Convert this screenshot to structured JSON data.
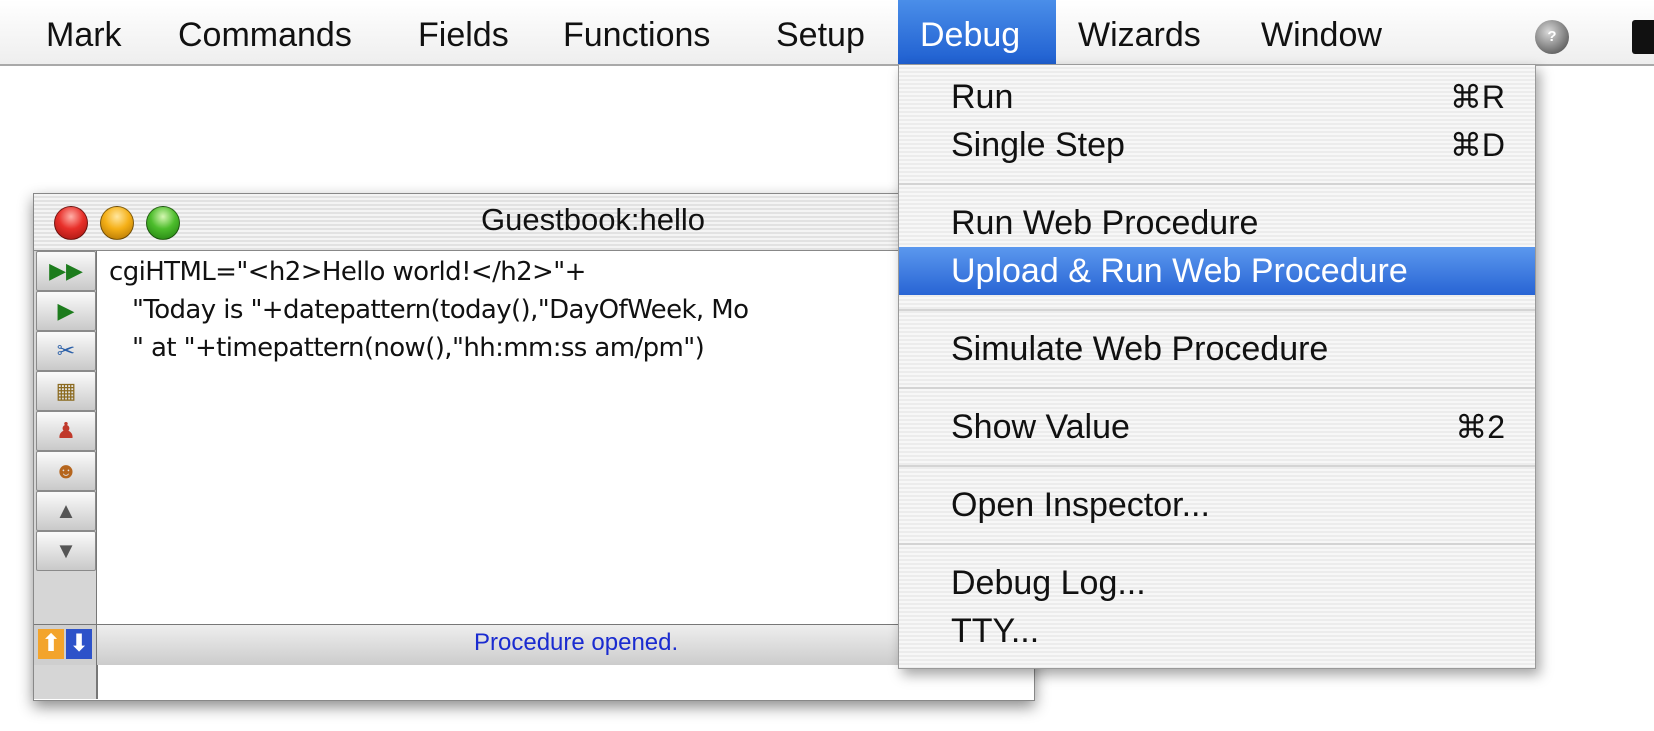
{
  "menubar": {
    "items": [
      {
        "label": "Mark"
      },
      {
        "label": "Commands"
      },
      {
        "label": "Fields"
      },
      {
        "label": "Functions"
      },
      {
        "label": "Setup"
      },
      {
        "label": "Debug",
        "active": true
      },
      {
        "label": "Wizards"
      },
      {
        "label": "Window"
      }
    ],
    "help_icon": "help-globe-icon"
  },
  "window": {
    "title": "Guestbook:hello",
    "code_lines": [
      "cgiHTML=\"<h2>Hello world!</h2>\"+",
      "   \"Today is \"+datepattern(today(),\"DayOfWeek, Mo",
      "   \" at \"+timepattern(now(),\"hh:mm:ss am/pm\")"
    ],
    "tools": [
      {
        "icon": "fast-forward-icon",
        "glyph": "▶▶"
      },
      {
        "icon": "play-icon",
        "glyph": "▶"
      },
      {
        "icon": "scissors-icon",
        "glyph": "✂"
      },
      {
        "icon": "puzzle-icon",
        "glyph": "▦"
      },
      {
        "icon": "stamp-icon",
        "glyph": "♟"
      },
      {
        "icon": "people-icon",
        "glyph": "☻"
      },
      {
        "icon": "scroll-up-icon",
        "glyph": "▲"
      },
      {
        "icon": "scroll-down-icon",
        "glyph": "▼"
      }
    ],
    "status_text": "Procedure opened."
  },
  "debug_menu": {
    "items": [
      {
        "label": "Run",
        "shortcut": "⌘R"
      },
      {
        "label": "Single Step",
        "shortcut": "⌘D"
      },
      {
        "label": "Run Web Procedure",
        "shortcut": ""
      },
      {
        "label": "Upload & Run Web Procedure",
        "shortcut": "",
        "selected": true
      },
      {
        "label": "Simulate Web Procedure",
        "shortcut": ""
      },
      {
        "label": "Show Value",
        "shortcut": "⌘2"
      },
      {
        "label": "Open Inspector...",
        "shortcut": ""
      },
      {
        "label": "Debug Log...",
        "shortcut": ""
      },
      {
        "label": "TTY...",
        "shortcut": ""
      }
    ]
  },
  "colors": {
    "menu_highlight": "#2864d4",
    "status_text": "#1a2bd0"
  }
}
